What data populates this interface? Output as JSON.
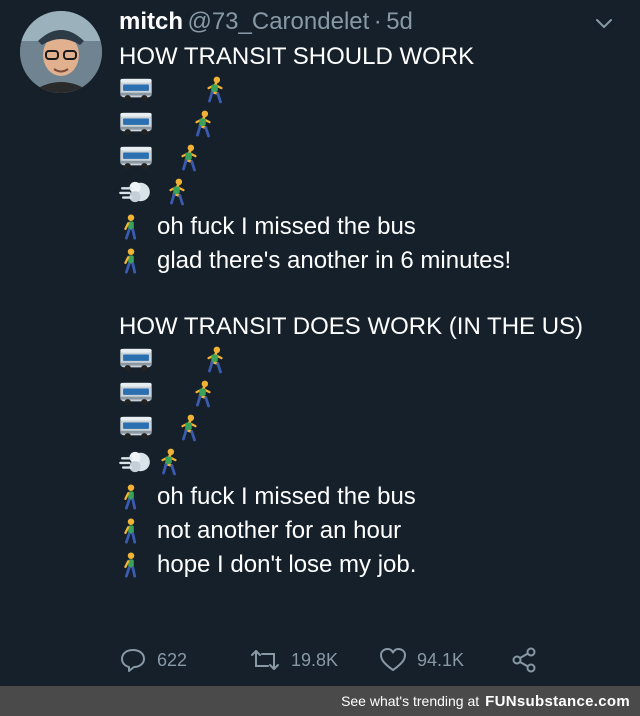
{
  "tweet": {
    "author_name": "mitch",
    "author_handle": "@73_Carondelet",
    "separator": "·",
    "time": "5d",
    "heading_1": "HOW TRANSIT SHOULD WORK",
    "lines_1": [
      "oh fuck I missed the bus",
      "glad there's another in 6 minutes!"
    ],
    "heading_2": "HOW TRANSIT DOES WORK (IN THE US)",
    "lines_2": [
      "oh fuck I missed the bus",
      "not another for an hour",
      "hope I don't lose my job."
    ]
  },
  "actions": {
    "reply_count": "622",
    "retweet_count": "19.8K",
    "like_count": "94.1K"
  },
  "footer": {
    "text": "See what's trending at",
    "brand": "FUNsubstance.com"
  },
  "icons": [
    "chevron-down-icon",
    "bus-icon",
    "runner-icon",
    "dash-icon",
    "walker-icon",
    "reply-icon",
    "retweet-icon",
    "like-icon",
    "share-icon"
  ],
  "colors": {
    "background": "#15202b",
    "secondary_text": "#8899a6",
    "footer_bg": "#4a4a4a"
  }
}
